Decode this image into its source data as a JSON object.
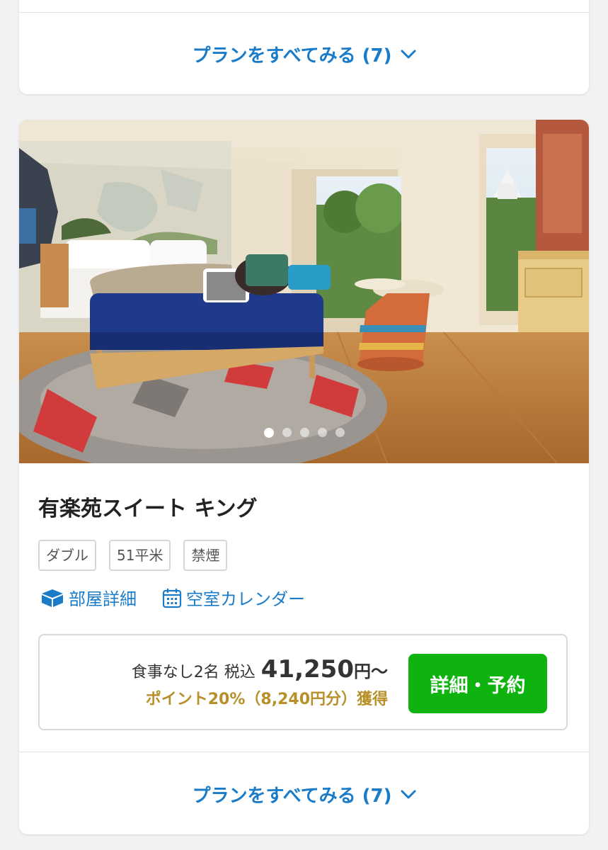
{
  "top_card": {
    "plans_link": "プランをすべてみる (7)"
  },
  "room": {
    "title": "有楽苑スイート キング",
    "tags": [
      "ダブル",
      "51平米",
      "禁煙"
    ],
    "links": {
      "room_details": "部屋詳細",
      "calendar": "空室カレンダー"
    },
    "carousel": {
      "total_slides": 5,
      "active_slide": 1
    },
    "price": {
      "condition": "食事なし2名 税込",
      "amount": "41,250",
      "suffix": "円〜",
      "points": "ポイント20%（8,240円分）獲得"
    },
    "reserve_button": "詳細・予約",
    "plans_link": "プランをすべてみる (7)"
  },
  "colors": {
    "accent_blue": "#1a7cc9",
    "reserve_green": "#0fb30f",
    "points_gold": "#b8902a"
  }
}
